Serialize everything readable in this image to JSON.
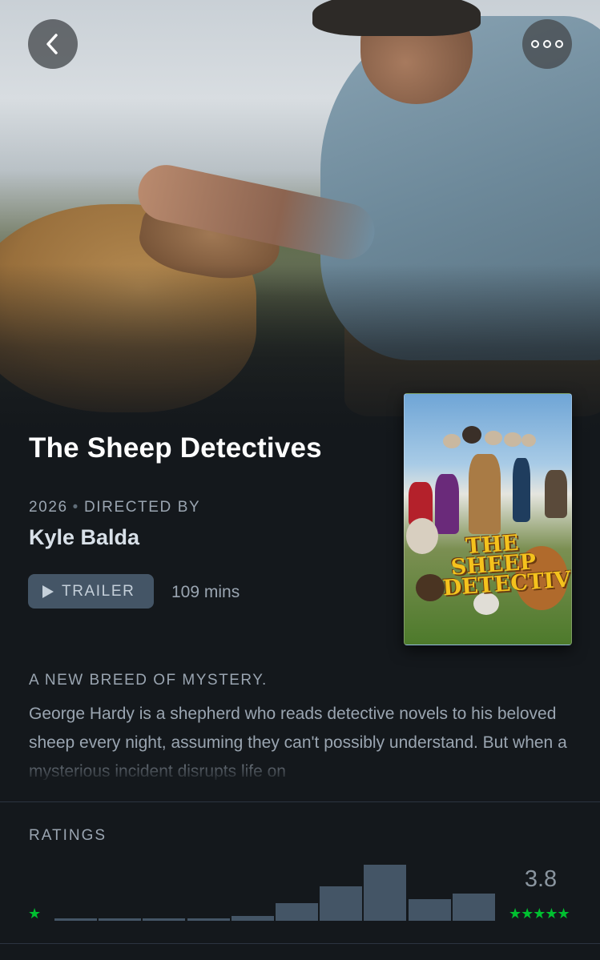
{
  "film": {
    "title": "The Sheep Detectives",
    "year": "2026",
    "directed_by_label": "DIRECTED BY",
    "director": "Kyle Balda",
    "trailer_label": "TRAILER",
    "runtime": "109 mins",
    "poster_title": "THE SHEEP DETECTIVES",
    "tagline": "A NEW BREED OF MYSTERY.",
    "synopsis": "George Hardy is a shepherd who reads detective novels to his beloved sheep every night, assuming they can't possibly understand. But when a mysterious incident disrupts life on"
  },
  "ratings": {
    "label": "RATINGS",
    "average": "3.8",
    "min_stars": "★",
    "max_stars": "★★★★★",
    "histogram": [
      0.04,
      0.04,
      0.04,
      0.05,
      0.08,
      0.32,
      0.62,
      1.0,
      0.39,
      0.49
    ]
  },
  "colors": {
    "background": "#14181c",
    "button": "#445566",
    "star": "#00c030",
    "text_muted": "#9aa5b1"
  },
  "icons": {
    "back": "chevron-left-icon",
    "more": "more-horizontal-icon",
    "play": "play-icon",
    "star": "star-icon"
  }
}
